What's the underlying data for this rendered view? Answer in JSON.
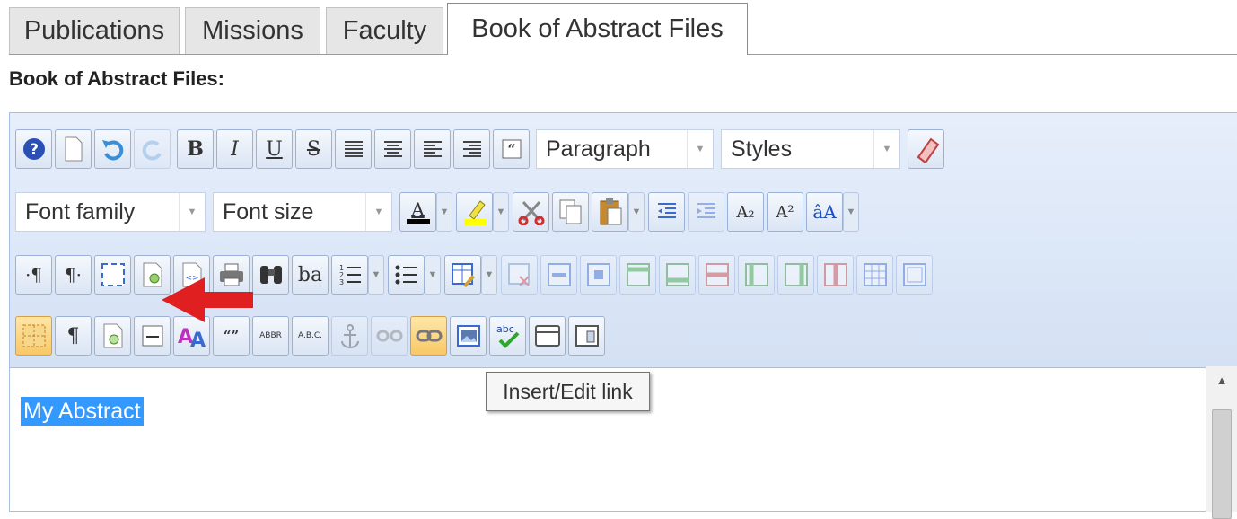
{
  "tabs": [
    {
      "label": "Publications"
    },
    {
      "label": "Missions"
    },
    {
      "label": "Faculty"
    },
    {
      "label": "Book of Abstract Files",
      "active": true
    }
  ],
  "section_title": "Book of Abstract Files:",
  "toolbar": {
    "row1": {
      "bold": "B",
      "italic": "I",
      "underline": "U",
      "strike": "S",
      "paragraph_select": "Paragraph",
      "styles_select": "Styles"
    },
    "row2": {
      "font_family_select": "Font family",
      "font_size_select": "Font size",
      "forecolor_letter": "A",
      "subscript": "A₂",
      "superscript": "A²",
      "charmap": "âA"
    },
    "row3": {
      "ltr": "·¶",
      "rtl": "¶·",
      "replace": "ba"
    },
    "row4": {
      "pilcrow": "¶",
      "cite": "“”",
      "abbr": "ABBR",
      "acronym": "A.B.C."
    }
  },
  "editor": {
    "content_text": "My Abstract"
  },
  "tooltip": "Insert/Edit link",
  "colors": {
    "toolbar_bg": "#dae5f5",
    "selection": "#3399ff",
    "arrow": "#e02020",
    "highlight_button": "#f8c866"
  }
}
